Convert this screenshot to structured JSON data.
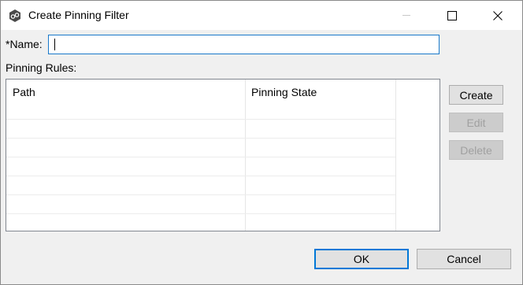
{
  "window": {
    "title": "Create Pinning Filter",
    "icon": "app-gear-icon",
    "controls": [
      "minimize-icon",
      "maximize-icon",
      "close-icon"
    ]
  },
  "form": {
    "name_label": "*Name:",
    "name_value": "",
    "rules_label": "Pinning Rules:"
  },
  "table": {
    "columns": [
      "Path",
      "Pinning State"
    ],
    "rows": []
  },
  "side_buttons": {
    "create": "Create",
    "edit": "Edit",
    "delete": "Delete"
  },
  "footer": {
    "ok": "OK",
    "cancel": "Cancel"
  },
  "colors": {
    "accent": "#0078d7",
    "input_focus_border": "#1979ca"
  }
}
